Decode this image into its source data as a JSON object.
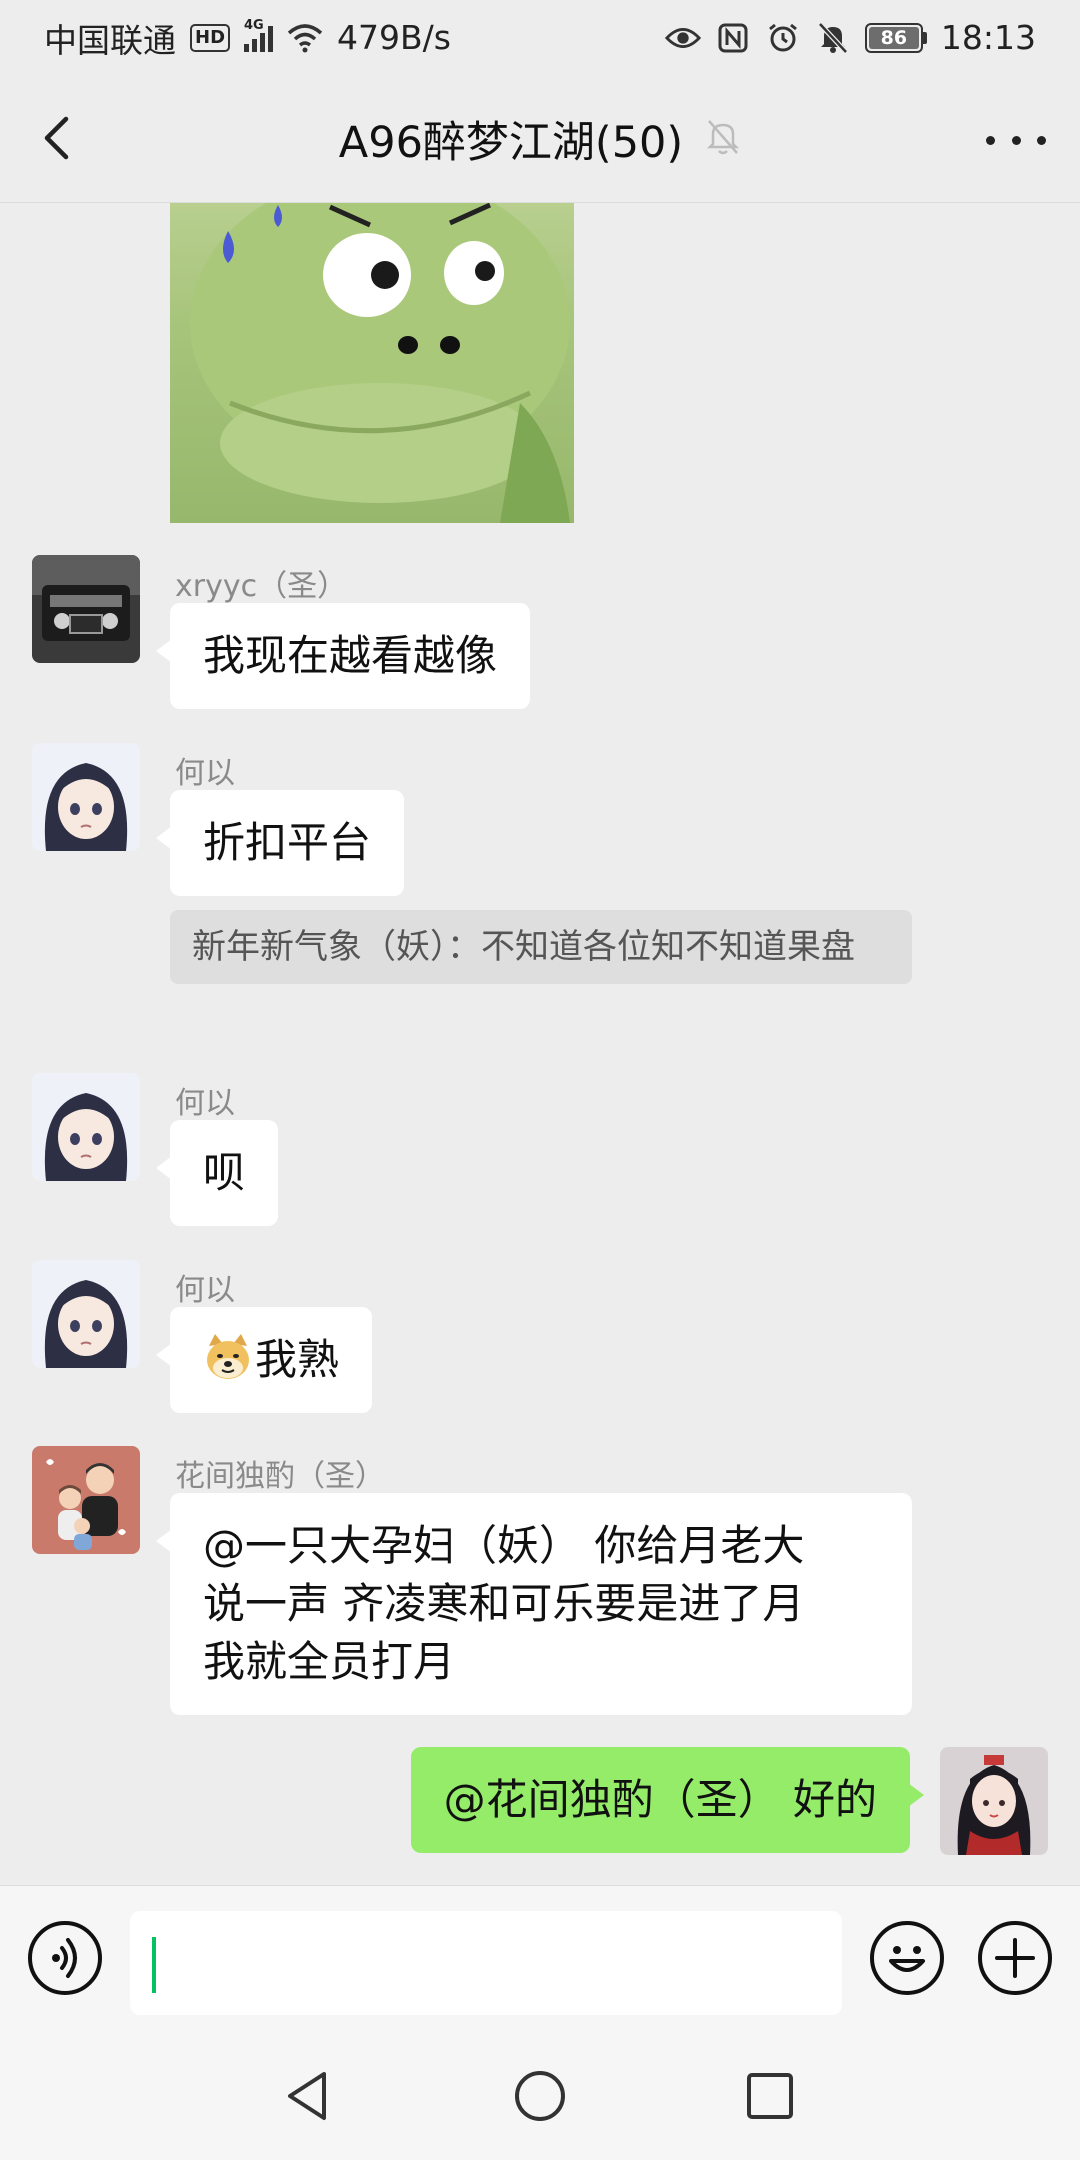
{
  "status_bar": {
    "carrier": "中国联通",
    "hd_badge": "HD",
    "signal_tag": "4G",
    "net_speed": "479B/s",
    "battery": "86",
    "time": "18:13",
    "icons": [
      "hd-icon",
      "signal-icon",
      "wifi-icon",
      "eye-icon",
      "nfc-icon",
      "alarm-icon",
      "mute-icon",
      "battery-icon"
    ]
  },
  "header": {
    "title": "A96醉梦江湖(50)",
    "back_icon": "chevron-left-icon",
    "muted_icon": "bell-off-icon",
    "more_icon": "more-dots-icon"
  },
  "messages": [
    {
      "type": "sticker",
      "description": "green frog sticker",
      "side": "left"
    },
    {
      "sender": "xryyc（圣）",
      "text": "我现在越看越像",
      "side": "left",
      "avatar": "car-avatar"
    },
    {
      "sender": "何以",
      "text": "折扣平台",
      "side": "left",
      "avatar": "anime-girl-avatar",
      "quote": "新年新气象（妖）：不知道各位知不知道果盘"
    },
    {
      "sender": "何以",
      "text": "呗",
      "side": "left",
      "avatar": "anime-girl-avatar"
    },
    {
      "sender": "何以",
      "text": "我熟",
      "emoji": "doge-emoji",
      "side": "left",
      "avatar": "anime-girl-avatar"
    },
    {
      "sender": "花间独酌（圣）",
      "text_lines": [
        "@一只大孕妇（妖） 你给月老大",
        "说一声 齐凌寒和可乐要是进了月",
        "我就全员打月"
      ],
      "side": "left",
      "avatar": "family-avatar"
    },
    {
      "text": "@花间独酌（圣） 好的",
      "side": "right",
      "avatar": "costume-girl-avatar"
    }
  ],
  "input_bar": {
    "voice_icon": "voice-icon",
    "emoji_icon": "smiley-icon",
    "add_icon": "plus-icon",
    "value": ""
  },
  "nav_bar": [
    "back-triangle-icon",
    "home-circle-icon",
    "recents-square-icon"
  ],
  "colors": {
    "background": "#ededed",
    "my_bubble": "#95ec69",
    "other_bubble": "#ffffff",
    "quote_bg": "#dedede",
    "caret": "#07c160"
  }
}
